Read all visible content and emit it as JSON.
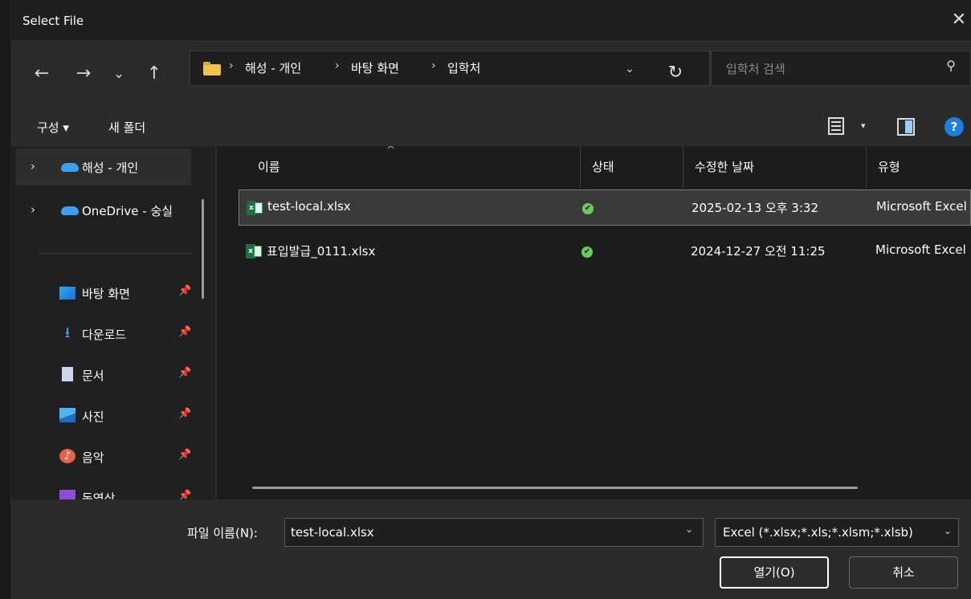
{
  "window": {
    "title": "Select File",
    "close_glyph": "✕"
  },
  "nav": {
    "back_glyph": "←",
    "forward_glyph": "→",
    "recent_glyph": "⌄",
    "up_glyph": "↑",
    "breadcrumbs": [
      "해성 - 개인",
      "바탕 화면",
      "입학처"
    ],
    "separator": "›",
    "dropdown_glyph": "⌄",
    "refresh_glyph": "↻",
    "search_placeholder": "입학처 검색",
    "search_glyph": "⚲"
  },
  "toolbar": {
    "organize_label": "구성 ▾",
    "new_folder_label": "새 폴더",
    "view_dropdown_glyph": "▾",
    "help_glyph": "?"
  },
  "sidebar": {
    "top_items": [
      {
        "label": "해성 - 개인",
        "chevron": "›"
      },
      {
        "label": "OneDrive - 숭실",
        "chevron": "›"
      }
    ],
    "quick_access": [
      {
        "label": "바탕 화면",
        "icon": "desktop-icon",
        "pin": "📌"
      },
      {
        "label": "다운로드",
        "icon": "download-icon",
        "glyph": "⭳",
        "pin": "📌"
      },
      {
        "label": "문서",
        "icon": "document-icon",
        "pin": "📌"
      },
      {
        "label": "사진",
        "icon": "pictures-icon",
        "pin": "📌"
      },
      {
        "label": "음악",
        "icon": "music-icon",
        "glyph": "♪",
        "pin": "📌"
      },
      {
        "label": "동영상",
        "icon": "videos-icon",
        "pin": "📌"
      }
    ]
  },
  "list": {
    "columns": [
      "이름",
      "상태",
      "수정한 날짜",
      "유형"
    ],
    "sort_glyph": "^",
    "files": [
      {
        "name": "test-local.xlsx",
        "status_glyph": "✔",
        "modified": "2025-02-13 오후 3:32",
        "type": "Microsoft Excel",
        "selected": true
      },
      {
        "name": "표입발급_0111.xlsx",
        "status_glyph": "✔",
        "modified": "2024-12-27 오전 11:25",
        "type": "Microsoft Excel",
        "selected": false
      }
    ],
    "excel_icon_letter": "x"
  },
  "footer": {
    "filename_label": "파일 이름(N):",
    "filename_value": "test-local.xlsx",
    "filename_dropdown_glyph": "⌄",
    "filter_value": "Excel (*.xlsx;*.xls;*.xlsm;*.xlsb)",
    "filter_dropdown_glyph": "⌄",
    "open_label": "열기(O)",
    "cancel_label": "취소"
  },
  "colors": {
    "accent_blue": "#1a7fe0",
    "excel_green": "#1d6f42",
    "status_green": "#6ccb5f",
    "folder_yellow": "#f2c14e"
  }
}
